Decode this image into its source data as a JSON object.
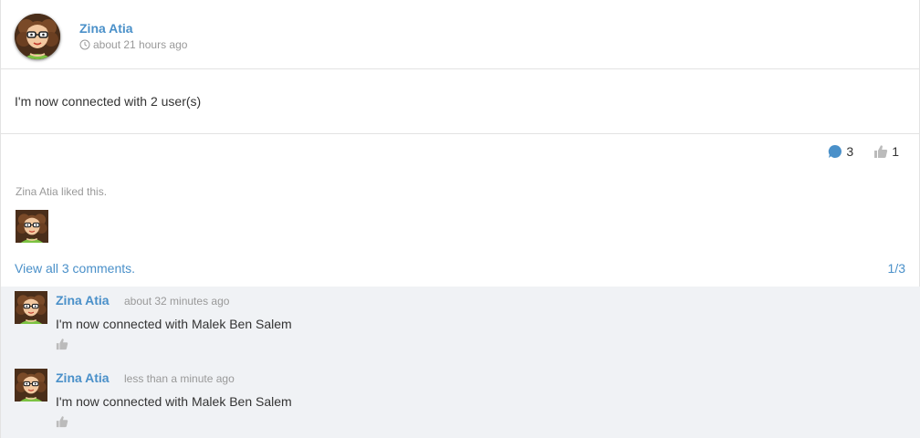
{
  "post": {
    "author": "Zina Atia",
    "time": "about 21 hours ago",
    "text": "I'm now connected with 2 user(s)"
  },
  "stats": {
    "comments_count": "3",
    "likes_count": "1"
  },
  "likes": {
    "text": "Zina Atia liked this."
  },
  "comments_section": {
    "view_all_label": "View all 3 comments.",
    "pager": "1/3",
    "items": [
      {
        "author": "Zina Atia",
        "time": "about 32 minutes ago",
        "text": "I'm now connected with Malek Ben Salem"
      },
      {
        "author": "Zina Atia",
        "time": "less than a minute ago",
        "text": "I'm now connected with Malek Ben Salem"
      }
    ]
  },
  "icons": {
    "clock": "clock-icon",
    "comment": "comment-bubble-icon",
    "like": "thumbs-up-icon"
  },
  "colors": {
    "link": "#4a90c9",
    "muted": "#999999",
    "comment_bg": "#f0f2f5",
    "comment_icon": "#4a90c9",
    "like_icon": "#bbbbbb"
  }
}
